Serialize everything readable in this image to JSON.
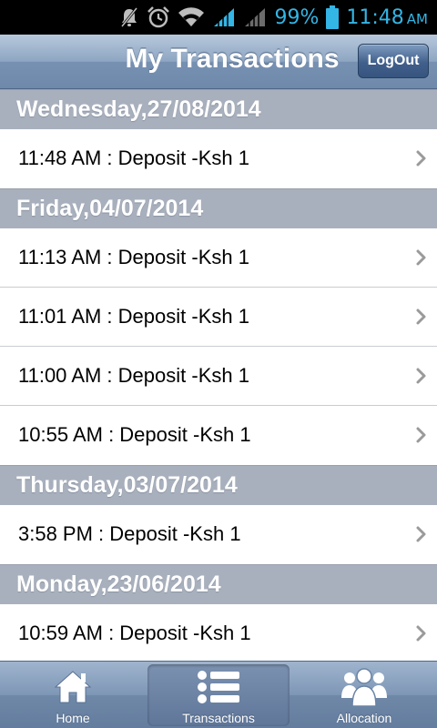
{
  "status_bar": {
    "battery_percent": "99%",
    "time": "11:48",
    "ampm": "AM",
    "icons": [
      "muted-icon",
      "alarm-icon",
      "wifi-icon",
      "signal-icon",
      "signal-weak-icon",
      "battery-icon"
    ],
    "color": "#33b5e5"
  },
  "header": {
    "title": "My Transactions",
    "logout_label": "LogOut"
  },
  "transactions": [
    {
      "date": "Wednesday,27/08/2014",
      "items": [
        "11:48 AM : Deposit -Ksh 1"
      ]
    },
    {
      "date": "Friday,04/07/2014",
      "items": [
        "11:13 AM : Deposit -Ksh 1",
        "11:01 AM : Deposit -Ksh 1",
        "11:00 AM : Deposit -Ksh 1",
        "10:55 AM : Deposit -Ksh 1"
      ]
    },
    {
      "date": "Thursday,03/07/2014",
      "items": [
        "3:58 PM : Deposit -Ksh 1"
      ]
    },
    {
      "date": "Monday,23/06/2014",
      "items": [
        "10:59 AM : Deposit -Ksh 1"
      ]
    }
  ],
  "tabs": [
    {
      "label": "Home",
      "icon": "home-icon",
      "active": false
    },
    {
      "label": "Transactions",
      "icon": "list-icon",
      "active": true
    },
    {
      "label": "Allocation",
      "icon": "group-icon",
      "active": false
    }
  ]
}
